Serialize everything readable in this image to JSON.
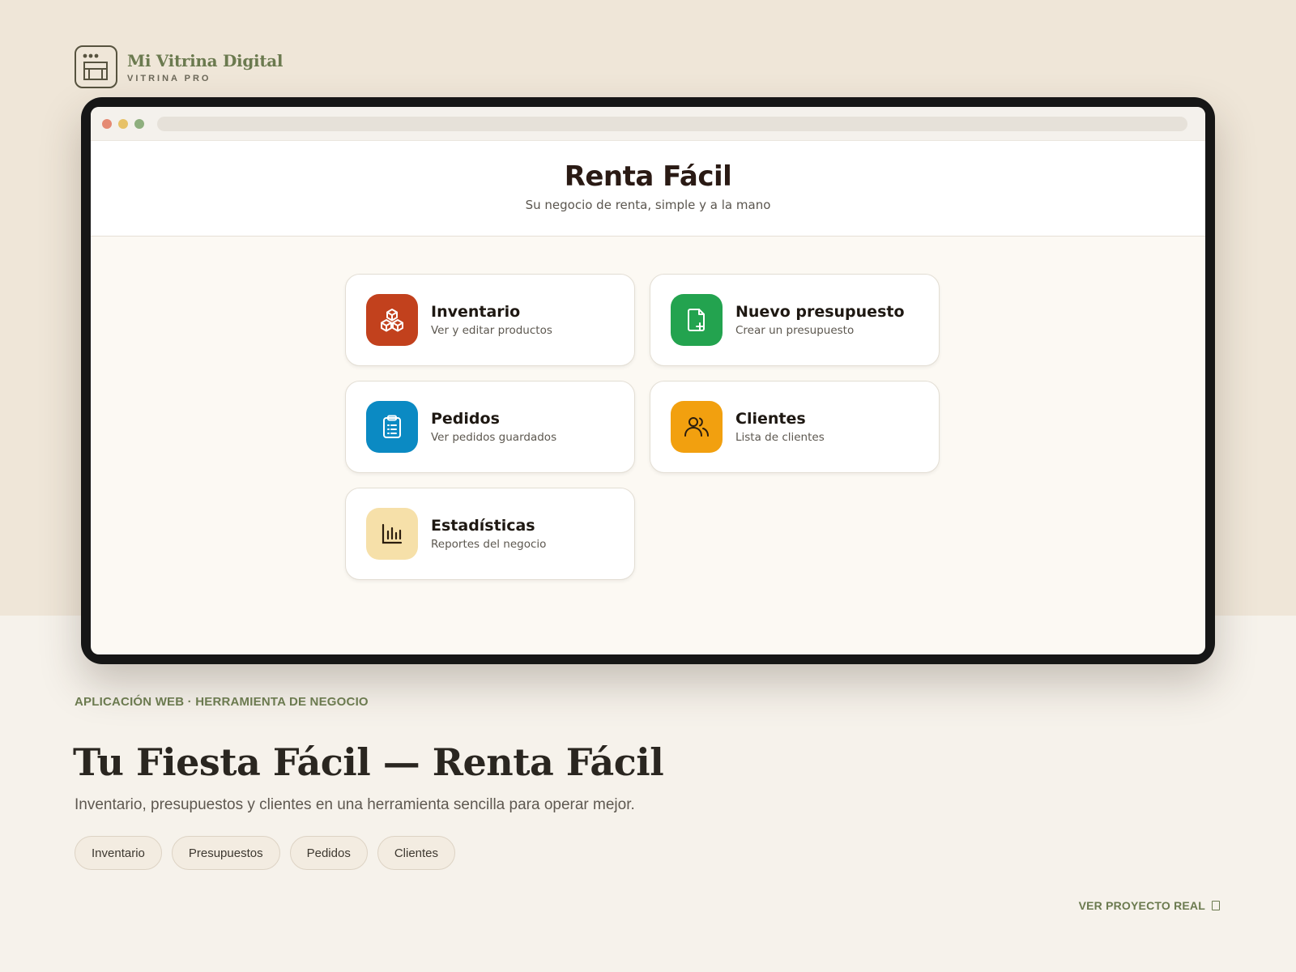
{
  "brand": {
    "name": "Mi Vitrina Digital",
    "tagline": "VITRINA PRO",
    "logo_icon": "storefront-icon"
  },
  "window_dots": [
    "#e58a73",
    "#e7c267",
    "#8eaf7e"
  ],
  "app": {
    "title": "Renta Fácil",
    "subtitle": "Su negocio de renta, simple y a la mano"
  },
  "cards": [
    {
      "title": "Inventario",
      "desc": "Ver y editar productos",
      "icon": "boxes-icon",
      "color": "#c2411d"
    },
    {
      "title": "Nuevo presupuesto",
      "desc": "Crear un presupuesto",
      "icon": "file-plus-icon",
      "color": "#23a34f"
    },
    {
      "title": "Pedidos",
      "desc": "Ver pedidos guardados",
      "icon": "clipboard-icon",
      "color": "#0b8ac3"
    },
    {
      "title": "Clientes",
      "desc": "Lista de clientes",
      "icon": "users-icon",
      "color": "#f2a00f"
    },
    {
      "title": "Estadísticas",
      "desc": "Reportes del negocio",
      "icon": "bar-chart-icon",
      "color": "#f6e0a9"
    }
  ],
  "project": {
    "eyebrow": "APLICACIÓN WEB · HERRAMIENTA DE NEGOCIO",
    "title": "Tu Fiesta Fácil — Renta Fácil",
    "description": "Inventario, presupuestos y clientes en una herramienta sencilla para operar mejor.",
    "tags": [
      "Inventario",
      "Presupuestos",
      "Pedidos",
      "Clientes"
    ],
    "cta": "VER PROYECTO REAL"
  },
  "colors": {
    "accent": "#6b7a4f",
    "background": "#f6f2eb",
    "top_band": "#efe6d8"
  }
}
